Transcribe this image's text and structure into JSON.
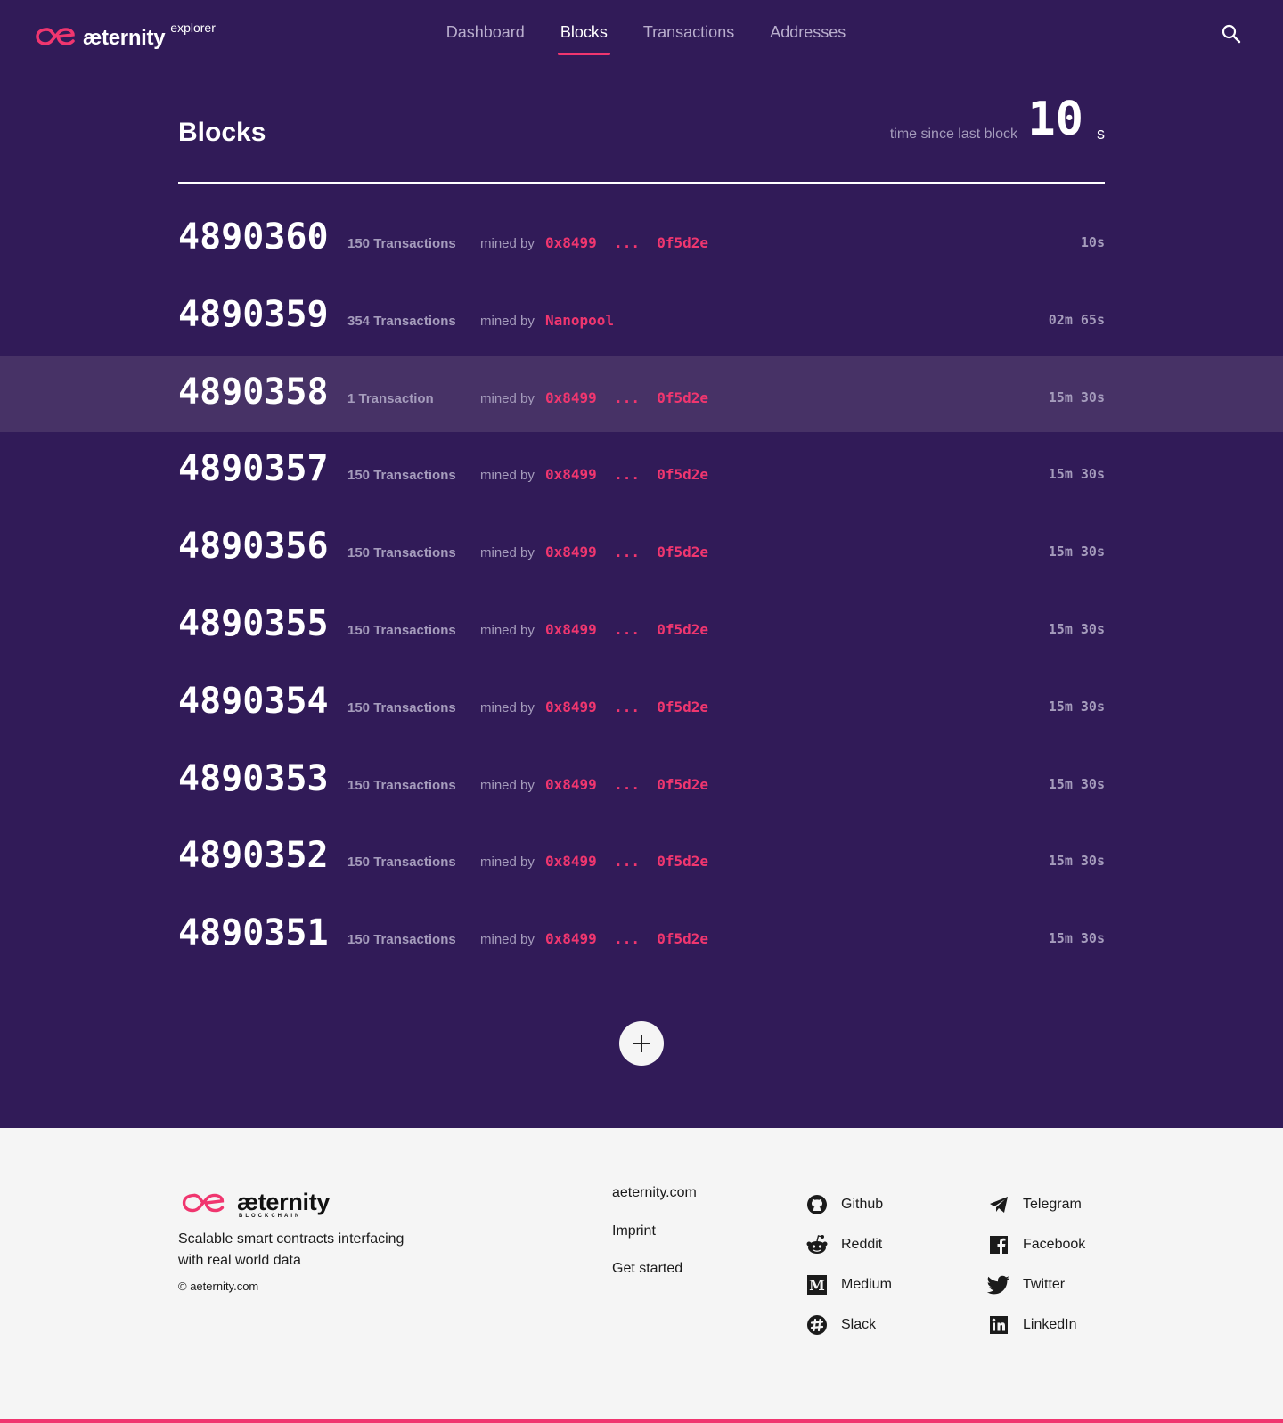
{
  "header": {
    "brand": "æternity",
    "brand_sup": "explorer",
    "nav": [
      "Dashboard",
      "Blocks",
      "Transactions",
      "Addresses"
    ],
    "active_nav": "Blocks"
  },
  "page": {
    "title": "Blocks",
    "since_label": "time since last block",
    "since_value": "10",
    "since_unit": "s"
  },
  "blocks": [
    {
      "number": "4890360",
      "tx": "150 Transactions",
      "mined_label": "mined by",
      "miner": "0x8499  ...  0f5d2e",
      "age": "10s"
    },
    {
      "number": "4890359",
      "tx": "354 Transactions",
      "mined_label": "mined by",
      "miner": "Nanopool",
      "age": "02m 65s"
    },
    {
      "number": "4890358",
      "tx": "1 Transaction",
      "mined_label": "mined by",
      "miner": "0x8499  ...  0f5d2e",
      "age": "15m 30s"
    },
    {
      "number": "4890357",
      "tx": "150 Transactions",
      "mined_label": "mined by",
      "miner": "0x8499  ...  0f5d2e",
      "age": "15m 30s"
    },
    {
      "number": "4890356",
      "tx": "150 Transactions",
      "mined_label": "mined by",
      "miner": "0x8499  ...  0f5d2e",
      "age": "15m 30s"
    },
    {
      "number": "4890355",
      "tx": "150 Transactions",
      "mined_label": "mined by",
      "miner": "0x8499  ...  0f5d2e",
      "age": "15m 30s"
    },
    {
      "number": "4890354",
      "tx": "150 Transactions",
      "mined_label": "mined by",
      "miner": "0x8499  ...  0f5d2e",
      "age": "15m 30s"
    },
    {
      "number": "4890353",
      "tx": "150 Transactions",
      "mined_label": "mined by",
      "miner": "0x8499  ...  0f5d2e",
      "age": "15m 30s"
    },
    {
      "number": "4890352",
      "tx": "150 Transactions",
      "mined_label": "mined by",
      "miner": "0x8499  ...  0f5d2e",
      "age": "15m 30s"
    },
    {
      "number": "4890351",
      "tx": "150 Transactions",
      "mined_label": "mined by",
      "miner": "0x8499  ...  0f5d2e",
      "age": "15m 30s"
    }
  ],
  "highlighted_row": 2,
  "footer": {
    "brand": "æternity",
    "brand_sub": "BLOCKCHAIN",
    "tagline": "Scalable smart contracts interfacing with real world data",
    "copyright": "© aeternity.com",
    "links": [
      "aeternity.com",
      "Imprint",
      "Get started"
    ],
    "social_left": [
      {
        "label": "Github",
        "icon": "github-icon"
      },
      {
        "label": "Reddit",
        "icon": "reddit-icon"
      },
      {
        "label": "Medium",
        "icon": "medium-icon"
      },
      {
        "label": "Slack",
        "icon": "slack-icon"
      }
    ],
    "social_right": [
      {
        "label": "Telegram",
        "icon": "telegram-icon"
      },
      {
        "label": "Facebook",
        "icon": "facebook-icon"
      },
      {
        "label": "Twitter",
        "icon": "twitter-icon"
      },
      {
        "label": "LinkedIn",
        "icon": "linkedin-icon"
      }
    ]
  },
  "colors": {
    "background": "#311b58",
    "accent": "#f0366f",
    "highlight_row": "#473266",
    "muted_text": "#a59cbc",
    "footer_bg": "#f5f5f5"
  }
}
